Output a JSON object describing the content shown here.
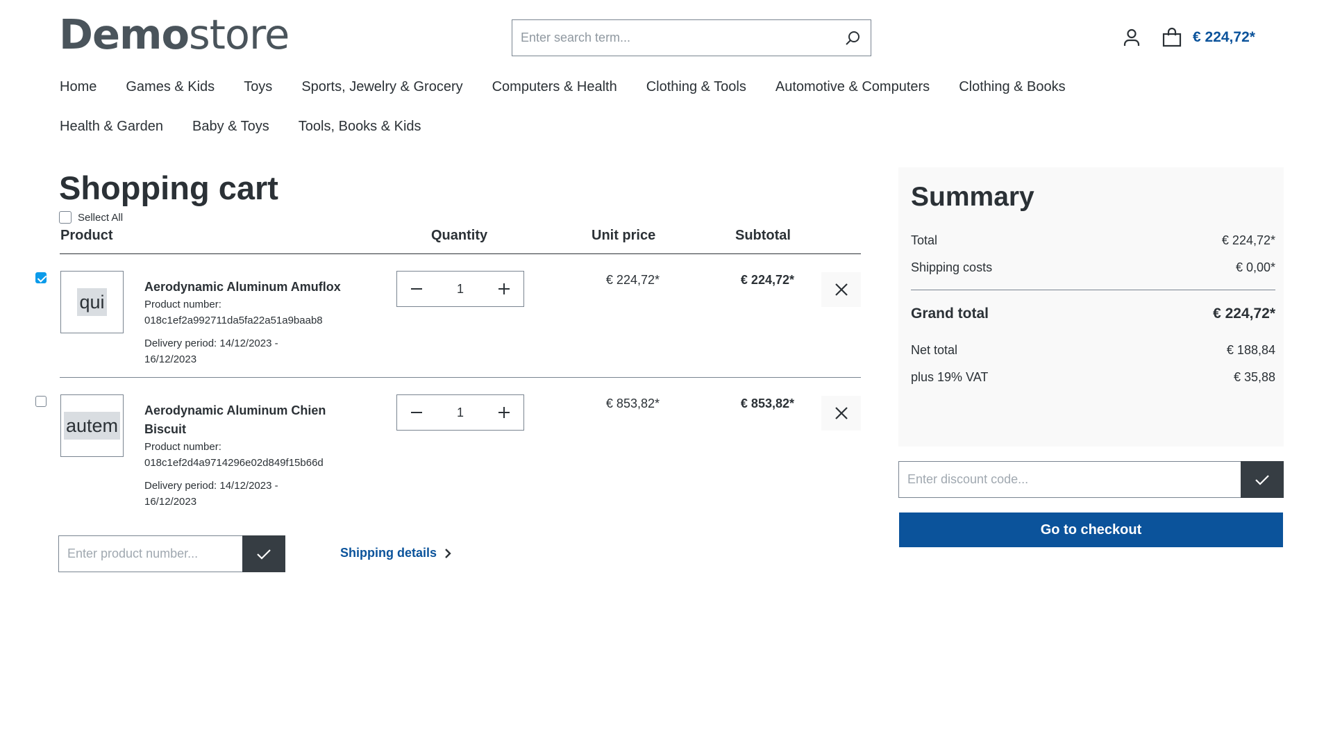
{
  "header": {
    "logo_bold": "Demo",
    "logo_light": "store",
    "search_placeholder": "Enter search term...",
    "cart_total": "€ 224,72*"
  },
  "nav": {
    "items": [
      "Home",
      "Games & Kids",
      "Toys",
      "Sports, Jewelry & Grocery",
      "Computers & Health",
      "Clothing & Tools",
      "Automotive & Computers",
      "Clothing & Books",
      "Health & Garden",
      "Baby & Toys",
      "Tools, Books & Kids"
    ]
  },
  "cart": {
    "title": "Shopping cart",
    "select_all_label": "Sellect All",
    "columns": {
      "product": "Product",
      "quantity": "Quantity",
      "unit_price": "Unit price",
      "subtotal": "Subtotal"
    },
    "items": [
      {
        "selected": true,
        "thumb_text": "qui",
        "name": "Aerodynamic Aluminum Amuflox",
        "product_number_label": "Product number:",
        "product_number": "018c1ef2a992711da5fa22a51a9baab8",
        "delivery_line1": "Delivery period: 14/12/2023 -",
        "delivery_line2": "16/12/2023",
        "quantity": "1",
        "unit_price": "€ 224,72*",
        "subtotal": "€ 224,72*"
      },
      {
        "selected": false,
        "thumb_text": "autem",
        "name": "Aerodynamic Aluminum Chien Biscuit",
        "product_number_label": "Product number:",
        "product_number": "018c1ef2d4a9714296e02d849f15b66d",
        "delivery_line1": "Delivery period: 14/12/2023 -",
        "delivery_line2": "16/12/2023",
        "quantity": "1",
        "unit_price": "€ 853,82*",
        "subtotal": "€ 853,82*"
      }
    ],
    "add_product_placeholder": "Enter product number...",
    "shipping_details_label": "Shipping details"
  },
  "summary": {
    "title": "Summary",
    "total_label": "Total",
    "total_value": "€ 224,72*",
    "shipping_label": "Shipping costs",
    "shipping_value": "€ 0,00*",
    "grand_total_label": "Grand total",
    "grand_total_value": "€ 224,72*",
    "net_total_label": "Net total",
    "net_total_value": "€ 188,84",
    "vat_label": "plus 19% VAT",
    "vat_value": "€ 35,88",
    "discount_placeholder": "Enter discount code...",
    "checkout_label": "Go to checkout"
  },
  "colors": {
    "brand_blue": "#0b539b",
    "checkbox_checked": "#0b9bea",
    "dark_button": "#363d43"
  }
}
